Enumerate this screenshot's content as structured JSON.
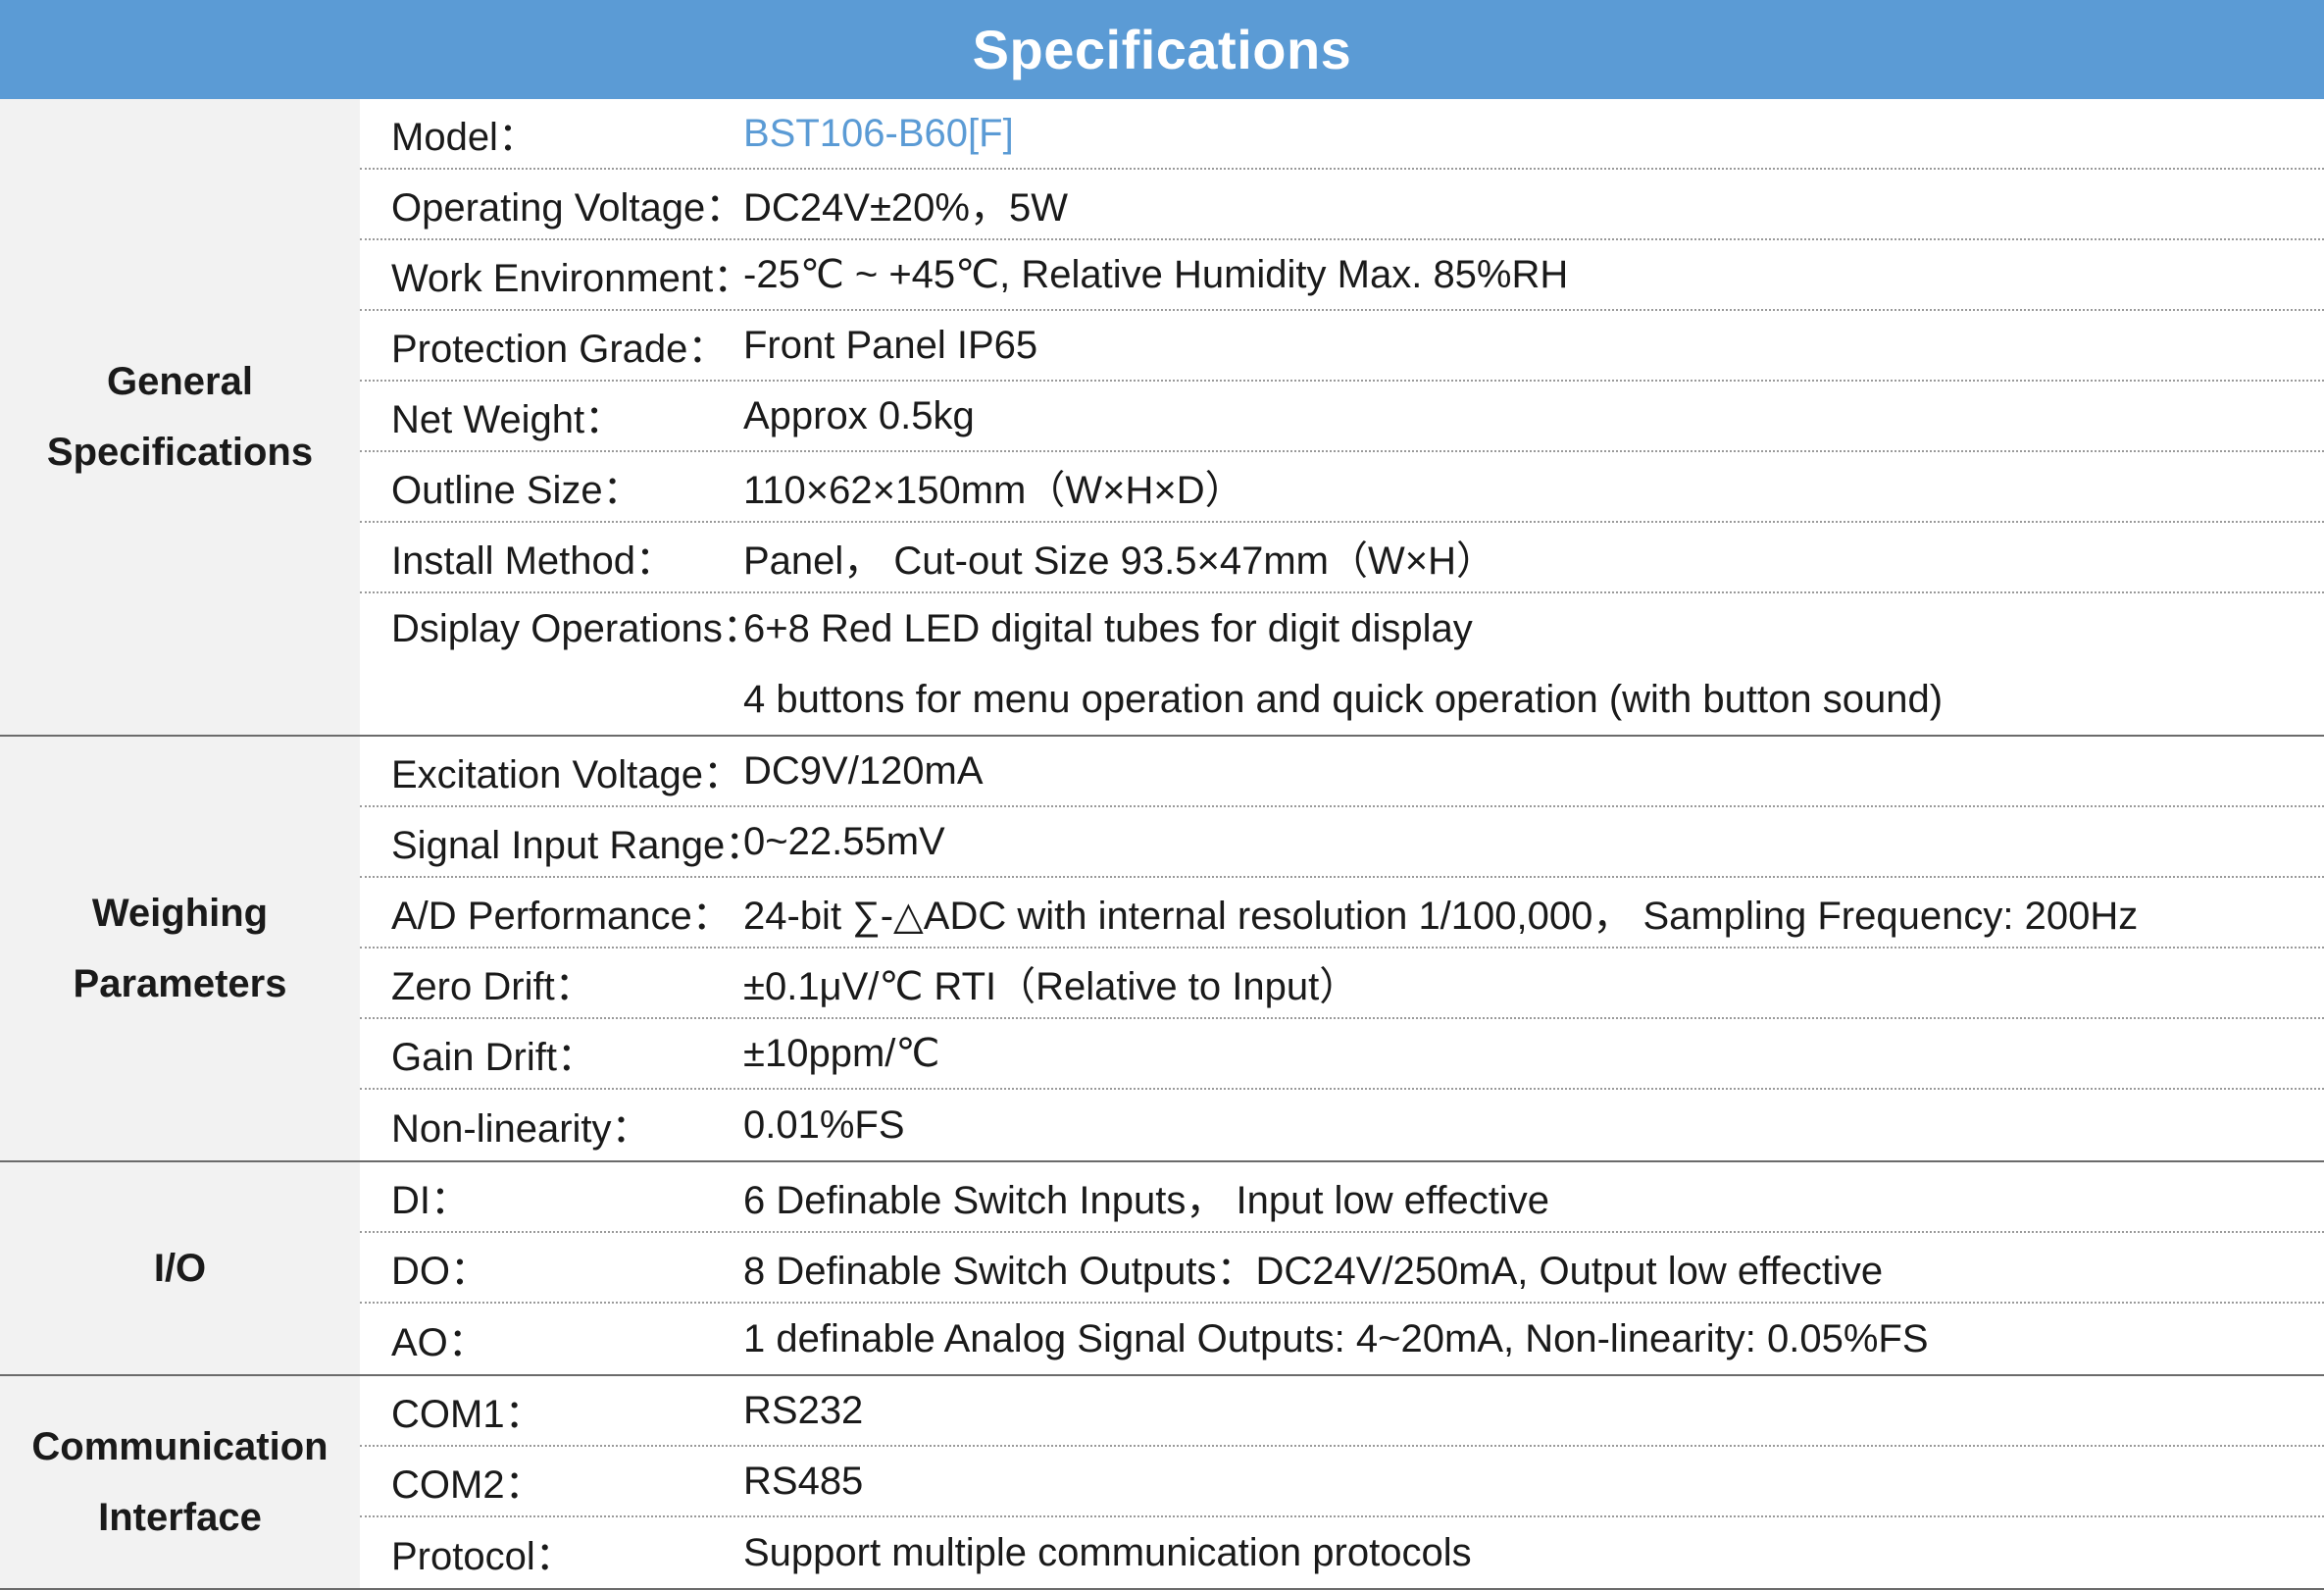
{
  "title": "Specifications",
  "sections": [
    {
      "name_line1": "General",
      "name_line2": "Specifications",
      "rows": [
        {
          "label": "Model：",
          "value": "BST106-B60[F]"
        },
        {
          "label": "Operating Voltage：",
          "value": "DC24V±20%，5W"
        },
        {
          "label": "Work Environment：",
          "value": "-25℃ ~ +45℃, Relative Humidity Max. 85%RH"
        },
        {
          "label": "Protection Grade：",
          "value": "Front Panel  IP65"
        },
        {
          "label": "Net Weight：",
          "value": "Approx  0.5kg"
        },
        {
          "label": "Outline Size：",
          "value": "110×62×150mm（W×H×D）"
        },
        {
          "label": "Install  Method：",
          "value": "Panel，  Cut-out Size  93.5×47mm（W×H）"
        },
        {
          "label": "Dsiplay Operations：",
          "value": "6+8 Red LED digital tubes for digit display",
          "value2": "4 buttons for menu operation and quick operation (with button sound)"
        }
      ]
    },
    {
      "name_line1": "Weighing",
      "name_line2": "Parameters",
      "rows": [
        {
          "label": "Excitation Voltage：",
          "value": "DC9V/120mA"
        },
        {
          "label": "Signal Input Range：",
          "value": "0~22.55mV"
        },
        {
          "label": "A/D Performance：",
          "value": "24-bit ∑-△ADC with internal resolution 1/100,000，  Sampling Frequency: 200Hz"
        },
        {
          "label": "Zero Drift：",
          "value": "±0.1μV/℃ RTI（Relative to Input）"
        },
        {
          "label": "Gain Drift：",
          "value": "±10ppm/℃"
        },
        {
          "label": "Non-linearity：",
          "value": "0.01%FS"
        }
      ]
    },
    {
      "name_line1": "I/O",
      "name_line2": "",
      "rows": [
        {
          "label": "DI：",
          "value": "6 Definable  Switch Inputs，  Input low effective"
        },
        {
          "label": "DO：",
          "value": "8 Definable  Switch Outputs：DC24V/250mA, Output low effective"
        },
        {
          "label": "AO：",
          "value": "1 definable Analog Signal Outputs: 4~20mA, Non-linearity: 0.05%FS"
        }
      ]
    },
    {
      "name_line1": "Communication",
      "name_line2": "Interface",
      "rows": [
        {
          "label": "COM1：",
          "value": "RS232"
        },
        {
          "label": "COM2：",
          "value": "RS485"
        },
        {
          "label": "Protocol：",
          "value": "Support multiple communication protocols"
        }
      ]
    }
  ],
  "colors": {
    "header": "#5b9bd5",
    "category_bg": "#f2f2f2",
    "model_value": "#5b9bd5"
  }
}
